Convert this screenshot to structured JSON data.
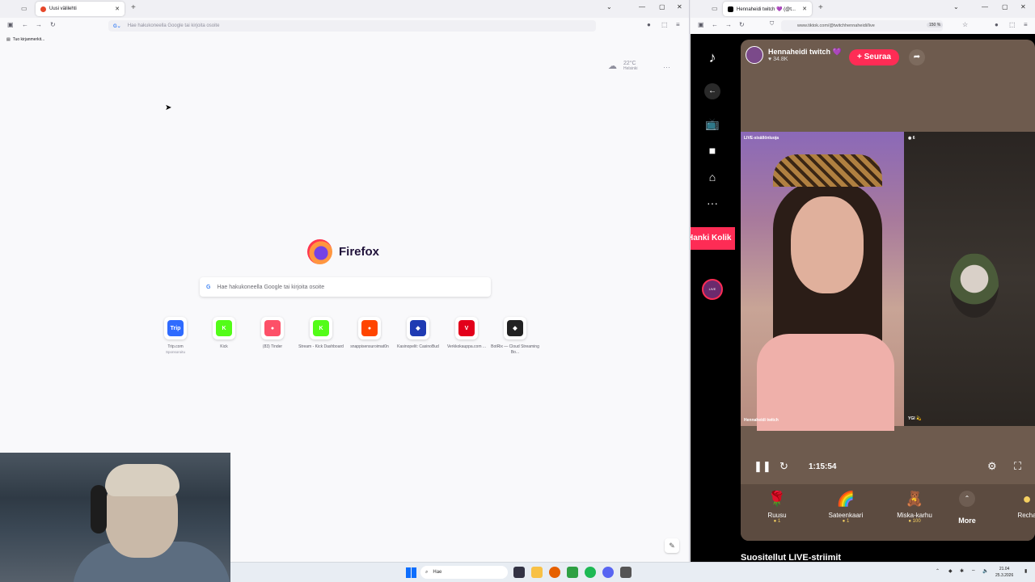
{
  "left_browser": {
    "tab_title": "Uusi välilehti",
    "urlbar_placeholder": "Hae hakukoneella Google tai kirjoita osoite",
    "bookmarks_import": "Tuo kirjanmerkit...",
    "weather_temp": "22°C",
    "weather_city": "Helsinki",
    "brand": "Firefox",
    "search_placeholder": "Hae hakukoneella Google tai kirjoita osoite",
    "shortcuts": [
      {
        "label": "Trip.com",
        "sub": "Sponsoroitu",
        "icon": "Trip",
        "color": "#2f6bff"
      },
      {
        "label": "Kick",
        "sub": "",
        "icon": "K",
        "color": "#53fc18"
      },
      {
        "label": "(83) Tinder",
        "sub": "",
        "icon": "●",
        "color": "#fd5068"
      },
      {
        "label": "Stream - Kick Dashboard",
        "sub": "",
        "icon": "K",
        "color": "#53fc18"
      },
      {
        "label": "snappisensuroimat0n",
        "sub": "",
        "icon": "●",
        "color": "#ff4500"
      },
      {
        "label": "Kasinopelit: CasinoBud",
        "sub": "",
        "icon": "◆",
        "color": "#1f3bb3"
      },
      {
        "label": "Verkkokauppa.com ...",
        "sub": "",
        "icon": "V",
        "color": "#e3001b"
      },
      {
        "label": "BotRix — Cloud Streaming Bo...",
        "sub": "",
        "icon": "◆",
        "color": "#222"
      }
    ]
  },
  "right_browser": {
    "tab_title": "Hennaheidi twitch 💜 (@t...",
    "url": "www.tiktok.com/@twitchhennaheidi/live",
    "zoom": "150 %",
    "banner_text": "Hanki Kolik",
    "host_name": "Hennaheidi twitch 💜",
    "host_likes": "♥ 34.8K",
    "follow_label": "+ Seuraa",
    "viewers": "6",
    "live_label": "LIVE-sisällönluoja",
    "left_name": "Hennaheidi twitch",
    "right_name": "YGI 💫",
    "timer": "1:15:54",
    "gifts": [
      {
        "name": "Ruusu",
        "price": "1",
        "icon": "🌹"
      },
      {
        "name": "Sateenkaari",
        "price": "1",
        "icon": "🌈"
      },
      {
        "name": "Miska-karhu",
        "price": "100",
        "icon": "🧸"
      }
    ],
    "more_label": "More",
    "recharge_label": "Recha",
    "recommend_title": "Suositellut LIVE-striimit",
    "live_badge": "LIVE"
  },
  "taskbar": {
    "search_placeholder": "Hae",
    "time": "21.04",
    "date": "25.3.2026"
  }
}
